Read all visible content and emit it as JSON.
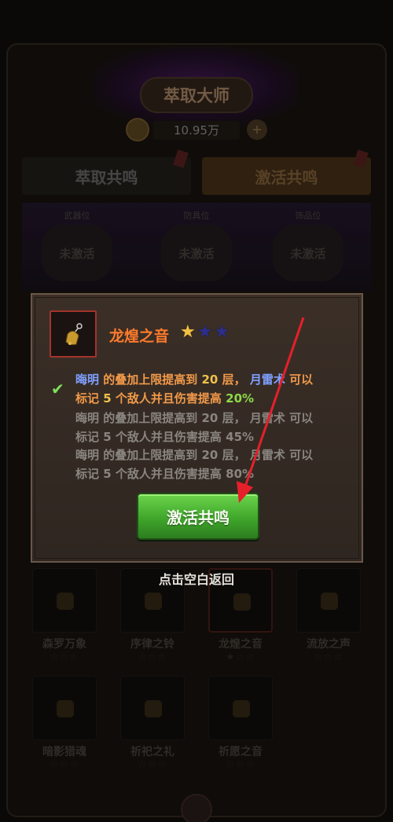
{
  "header": {
    "title": "萃取大师",
    "currency": "10.95万"
  },
  "tabs": [
    {
      "label": "萃取共鸣"
    },
    {
      "label": "激活共鸣"
    }
  ],
  "slots": [
    {
      "label": "武器位",
      "status": "未激活"
    },
    {
      "label": "防具位",
      "status": "未激活"
    },
    {
      "label": "饰品位",
      "status": "未激活"
    }
  ],
  "modal": {
    "item_name": "龙煌之音",
    "stars_filled": 1,
    "stars_total": 3,
    "effects": [
      {
        "active": true,
        "skill1": "晦明",
        "t1": "的叠加上限提高到",
        "n1": "20",
        "t2": "层，",
        "skill2": "月雷术",
        "t3": "可以",
        "t4": "标记",
        "n2": "5",
        "t5": "个敌人并且伤害提高",
        "pct": "20%"
      },
      {
        "active": false,
        "skill1": "晦明",
        "t1": "的叠加上限提高到",
        "n1": "20",
        "t2": "层，",
        "skill2": "月雷术",
        "t3": "可以",
        "t4": "标记",
        "n2": "5",
        "t5": "个敌人并且伤害提高",
        "pct": "45%"
      },
      {
        "active": false,
        "skill1": "晦明",
        "t1": "的叠加上限提高到",
        "n1": "20",
        "t2": "层，",
        "skill2": "月雷术",
        "t3": "可以",
        "t4": "标记",
        "n2": "5",
        "t5": "个敌人并且伤害提高",
        "pct": "80%"
      }
    ],
    "button_label": "激活共鸣"
  },
  "hint": "点击空白返回",
  "items": [
    {
      "name": "森罗万象",
      "stars": "☆☆☆"
    },
    {
      "name": "序律之铃",
      "stars": "☆☆☆"
    },
    {
      "name": "龙煌之音",
      "stars": "★☆☆"
    },
    {
      "name": "流放之声",
      "stars": "☆☆☆"
    },
    {
      "name": "暗影猎魂",
      "stars": "☆☆☆"
    },
    {
      "name": "祈祀之礼",
      "stars": "☆☆☆"
    },
    {
      "name": "祈愿之音",
      "stars": "☆☆☆"
    }
  ],
  "colors": {
    "accent_green": "#3fa62b",
    "item_name": "#ff7b2c",
    "arrow": "#e5202a"
  }
}
